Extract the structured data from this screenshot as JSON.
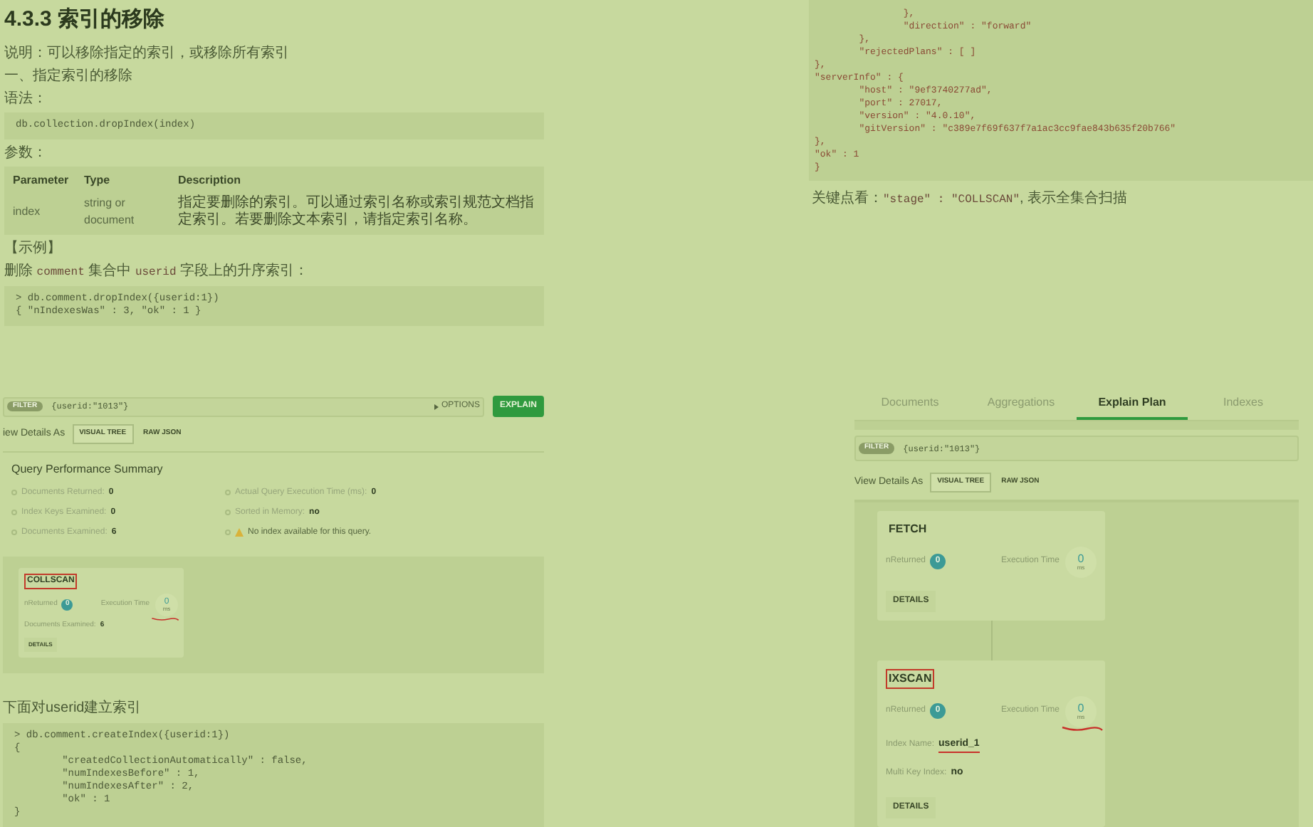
{
  "article_top": [
    {
      "kind": "heading",
      "text": "4.3.3 索引的移除"
    },
    {
      "kind": "text",
      "parts": [
        {
          "text": "说明：可以移除指定的索引，或移除所有索引",
          "code": false
        }
      ]
    },
    {
      "kind": "text",
      "parts": [
        {
          "text": "一、指定索引的移除",
          "code": false
        }
      ]
    },
    {
      "kind": "text",
      "parts": [
        {
          "text": "语法：",
          "code": false
        }
      ]
    },
    {
      "kind": "code",
      "lines": [
        "db.collection.dropIndex(index)"
      ]
    },
    {
      "kind": "text",
      "parts": [
        {
          "text": "参数：",
          "code": false
        }
      ]
    },
    {
      "kind": "table",
      "columns": [
        "Parameter",
        "Type",
        "Description"
      ],
      "rows": [
        [
          "index",
          "string or document",
          "指定要删除的索引。可以通过索引名称或索引规范文档指定索引。若要删除文本索引，请指定索引名称。"
        ]
      ]
    },
    {
      "kind": "text",
      "parts": [
        {
          "text": "【示例】",
          "code": false
        }
      ]
    },
    {
      "kind": "text",
      "parts": [
        {
          "text": "删除 ",
          "code": false
        },
        {
          "text": "comment",
          "code": true
        },
        {
          "text": " 集合中 ",
          "code": false
        },
        {
          "text": "userid",
          "code": true
        },
        {
          "text": " 字段上的升序索引：",
          "code": false
        }
      ]
    },
    {
      "kind": "code",
      "lines": [
        "> db.comment.dropIndex({userid:1})",
        "{ \"nIndexesWas\" : 3, \"ok\" : 1 }"
      ]
    }
  ],
  "output_top": {
    "code": {
      "kind": "code",
      "lines": [
        "                },",
        "                \"direction\" : \"forward\"",
        "        },",
        "        \"rejectedPlans\" : [ ]",
        "},",
        "\"serverInfo\" : {",
        "        \"host\" : \"9ef3740277ad\",",
        "        \"port\" : 27017,",
        "        \"version\" : \"4.0.10\",",
        "        \"gitVersion\" : \"c389e7f69f637f7a1ac3cc9fae843b635f20b766\"",
        "},",
        "\"ok\" : 1",
        "}"
      ]
    },
    "note": {
      "kind": "text",
      "parts": [
        {
          "text": "关键点看：",
          "code": false
        },
        {
          "text": "\"stage\" : \"COLLSCAN\"",
          "code": true
        },
        {
          "text": ", 表示全集合扫描",
          "code": false
        }
      ]
    }
  },
  "explain_left": {
    "filter_label": "FILTER",
    "query": "{userid:\"1013\"}",
    "options": "OPTIONS",
    "explain_button": "EXPLAIN",
    "view_label": "iew Details As",
    "view_buttons": [
      {
        "label": "VISUAL TREE",
        "selected": true
      },
      {
        "label": "RAW JSON",
        "selected": false
      }
    ],
    "summary_title": "Query Performance Summary",
    "summary": [
      {
        "kind": "stat",
        "label": "Documents Returned:",
        "value": "0"
      },
      {
        "kind": "stat",
        "label": "Actual Query Execution Time (ms):",
        "value": "0"
      },
      {
        "kind": "stat",
        "label": "Index Keys Examined:",
        "value": "0"
      },
      {
        "kind": "stat",
        "label": "Sorted in Memory:",
        "value": "no"
      },
      {
        "kind": "stat",
        "label": "Documents Examined:",
        "value": "6"
      },
      {
        "kind": "warning",
        "label": "No index available for this query."
      }
    ],
    "cards": [
      {
        "title": "COLLSCAN",
        "title_boxed": true,
        "returned_label": "nReturned",
        "returned": "0",
        "time_label": "Execution Time",
        "time": "0",
        "time_unit": "ms",
        "time_underlined": true,
        "fields": [
          {
            "label": "Documents Examined:",
            "value": "6",
            "underlined": false
          }
        ],
        "details": "DETAILS"
      }
    ]
  },
  "after_text": {
    "kind": "text",
    "parts": [
      {
        "text": "下面对userid建立索引",
        "code": false
      }
    ]
  },
  "after_code": {
    "kind": "code",
    "lines": [
      "> db.comment.createIndex({userid:1})",
      "{",
      "        \"createdCollectionAutomatically\" : false,",
      "        \"numIndexesBefore\" : 1,",
      "        \"numIndexesAfter\" : 2,",
      "        \"ok\" : 1",
      "}"
    ]
  },
  "explain_right": {
    "tabs": [
      {
        "label": "Documents",
        "selected": false
      },
      {
        "label": "Aggregations",
        "selected": false
      },
      {
        "label": "Explain Plan",
        "selected": true
      },
      {
        "label": "Indexes",
        "selected": false
      }
    ],
    "filter_label": "FILTER",
    "query": "{userid:\"1013\"}",
    "view_label": "View Details As",
    "view_buttons": [
      {
        "label": "VISUAL TREE",
        "selected": true
      },
      {
        "label": "RAW JSON",
        "selected": false
      }
    ],
    "cards": [
      {
        "title": "FETCH",
        "title_boxed": false,
        "returned_label": "nReturned",
        "returned": "0",
        "time_label": "Execution Time",
        "time": "0",
        "time_unit": "ms",
        "time_underlined": false,
        "details": "DETAILS"
      },
      {
        "title": "IXSCAN",
        "title_boxed": true,
        "returned_label": "nReturned",
        "returned": "0",
        "time_label": "Execution Time",
        "time": "0",
        "time_unit": "ms",
        "time_underlined": true,
        "fields": [
          {
            "label": "Index Name:",
            "value": "userid_1",
            "underlined": true
          },
          {
            "label": "Multi Key Index:",
            "value": "no",
            "underlined": false
          }
        ],
        "details": "DETAILS"
      }
    ]
  }
}
